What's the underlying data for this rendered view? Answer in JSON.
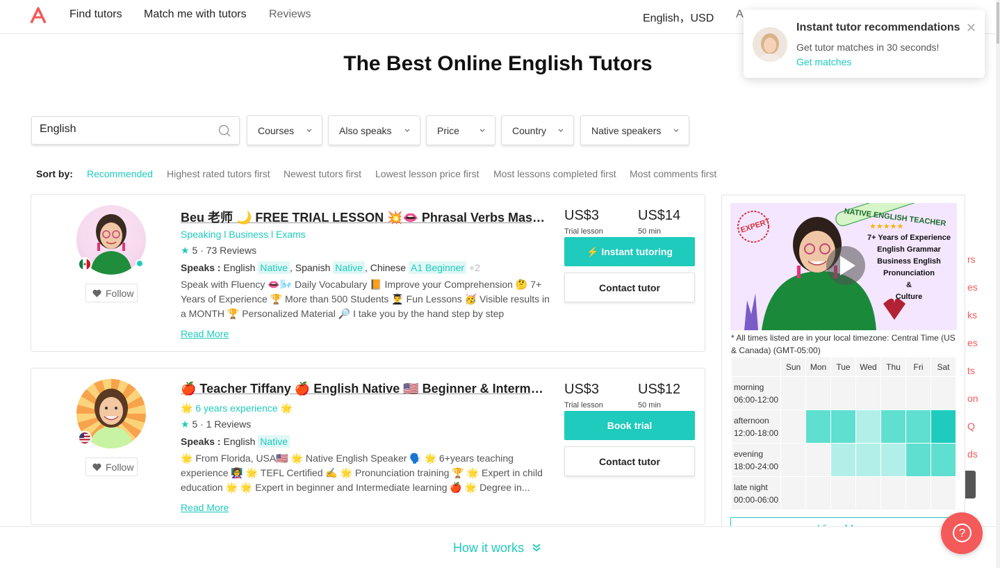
{
  "nav": {
    "find_tutors": "Find tutors",
    "match_me": "Match me with tutors",
    "reviews": "Reviews",
    "locale": "English，USD",
    "truncated": "A"
  },
  "page_title": "The Best Online English Tutors",
  "search": {
    "value": "English"
  },
  "filters": [
    "Courses",
    "Also speaks",
    "Price",
    "Country",
    "Native speakers"
  ],
  "sort": {
    "label": "Sort by:",
    "options": [
      "Recommended",
      "Highest rated tutors first",
      "Newest tutors first",
      "Lowest lesson price first",
      "Most lessons completed first",
      "Most comments first"
    ]
  },
  "tutors": [
    {
      "name": "Beu 老师 🌙 FREE TRIAL LESSON 💥👄 Phrasal Verbs Mastery",
      "tagline": "Speaking l Business l Exams",
      "rating": "5",
      "reviews": "73 Reviews",
      "speaks_label": "Speaks :",
      "lang1": "English",
      "lvl1": "Native",
      "lang2": "Spanish",
      "lvl2": "Native",
      "lang3": "Chinese",
      "lvl3": "A1 Beginner",
      "more": "+2",
      "description": "Speak with Fluency 👄🌬️ Daily Vocabulary 📙 Improve your Comprehension 🤔 7+ Years of Experience 🏆 More than 500 Students 👨‍🎓 Fun Lessons 🥳 Visible results in a MONTH 🏆 Personalized Material 🔎 I take you by the hand step by step",
      "read_more": "Read More",
      "follow": "Follow",
      "trial_price": "US$3",
      "trial_label": "Trial lesson",
      "lesson_price": "US$14",
      "lesson_label": "50 min",
      "primary_btn": "⚡ Instant tutoring",
      "contact_btn": "Contact tutor"
    },
    {
      "name": "🍎 Teacher Tiffany 🍎 English Native 🇺🇸 Beginner & Intermediate",
      "tagline": "🌟 6 years experience 🌟",
      "rating": "5",
      "reviews": "1 Reviews",
      "speaks_label": "Speaks :",
      "lang1": "English",
      "lvl1": "Native",
      "description": "🌟 From Florida, USA🇺🇸 🌟 Native English Speaker 🗣️ 🌟 6+years teaching experience 👩‍🏫 🌟 TEFL Certified ✍️ 🌟 Pronunciation training 🏆 🌟 Expert in child education 🌟 🌟 Expert in beginner and Intermediate learning 🍎 🌟 Degree in...",
      "read_more": "Read More",
      "follow": "Follow",
      "trial_price": "US$3",
      "trial_label": "Trial lesson",
      "lesson_price": "US$12",
      "lesson_label": "50 min",
      "primary_btn": "Book trial",
      "contact_btn": "Contact tutor"
    }
  ],
  "video": {
    "badge": "EXPERT",
    "headline": "NATIVE ENGLISH TEACHER",
    "stars": "★★★★★",
    "lines": [
      "7+ Years of Experience",
      "English Grammar",
      "Business English",
      "Pronunciation",
      "&",
      "Culture"
    ]
  },
  "schedule": {
    "tz_note": "* All times listed are in your local timezone: Central Time (US & Canada) (GMT-05:00)",
    "days": [
      "Sun",
      "Mon",
      "Tue",
      "Wed",
      "Thu",
      "Fri",
      "Sat"
    ],
    "rows": [
      {
        "name": "morning",
        "hours": "06:00-12:00",
        "levels": [
          0,
          0,
          0,
          0,
          0,
          0,
          0
        ]
      },
      {
        "name": "afternoon",
        "hours": "12:00-18:00",
        "levels": [
          0,
          2,
          2,
          1,
          2,
          2,
          3
        ]
      },
      {
        "name": "evening",
        "hours": "18:00-24:00",
        "levels": [
          0,
          0,
          1,
          1,
          1,
          2,
          2
        ]
      },
      {
        "name": "late night",
        "hours": "00:00-06:00",
        "levels": [
          0,
          0,
          0,
          0,
          0,
          0,
          0
        ]
      }
    ],
    "view_more": "View More"
  },
  "toast": {
    "title": "Instant tutor recommendations",
    "body": "Get tutor matches in 30 seconds!",
    "link": "Get matches"
  },
  "side_fragments": [
    "rs",
    "es",
    "ks",
    "es",
    "ts",
    "on",
    "Q",
    "ds"
  ],
  "bottom": {
    "how": "How it works"
  },
  "colors": {
    "accent": "#1ecbbd",
    "help": "#f45a5a"
  }
}
